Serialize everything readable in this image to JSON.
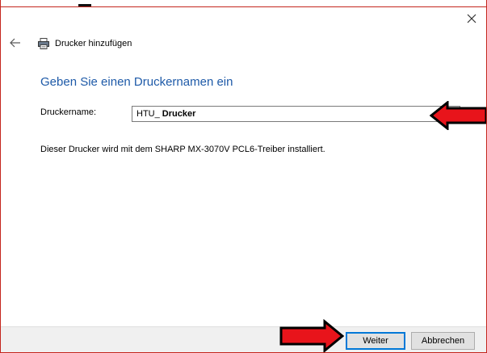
{
  "window": {
    "title": "Drucker hinzufügen",
    "close_icon": "close-icon",
    "back_icon": "back-arrow-icon",
    "printer_icon": "printer-icon"
  },
  "content": {
    "heading": "Geben Sie einen Druckernamen ein",
    "field_label": "Druckername:",
    "printer_name_prefix": "HTU_",
    "printer_name_suffix": "Drucker",
    "driver_info": "Dieser Drucker wird mit dem SHARP MX-3070V PCL6-Treiber installiert."
  },
  "footer": {
    "next_label": "Weiter",
    "cancel_label": "Abbrechen"
  },
  "annotations": {
    "arrow_color": "#e8141b",
    "arrow_outline": "#000000",
    "accent": "#1e5aa8",
    "window_border": "#c4261d"
  }
}
